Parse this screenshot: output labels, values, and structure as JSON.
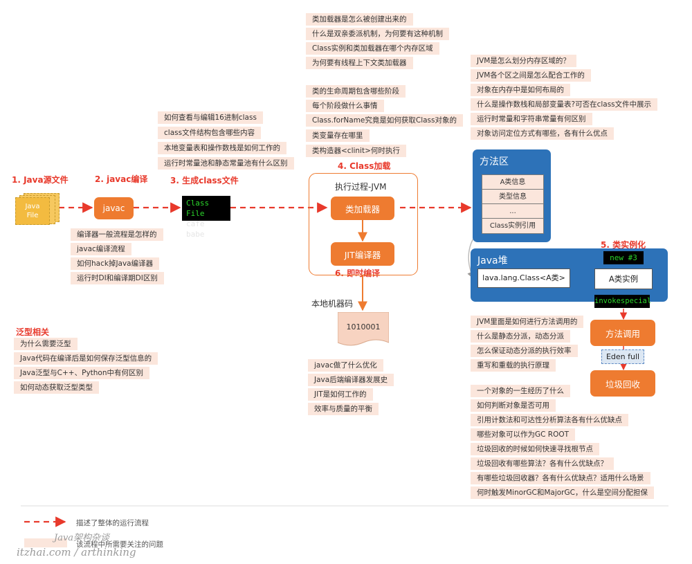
{
  "stages": {
    "java_source": "1. Java源文件",
    "javac_compile": "2. javac编译",
    "gen_class": "3. 生成class文件",
    "class_load": "4. Class加载",
    "instantiate": "5. 类实例化",
    "jit": "6. 即时编译"
  },
  "nodes": {
    "java_file": "Java\nFile",
    "javac": "javac",
    "class_file_line1": "Class File",
    "class_file_line2": "cafe babe",
    "jvm_title": "执行过程-JVM",
    "class_loader": "类加载器",
    "jit_compiler": "JIT编译器",
    "native_code_label": "本地机器码",
    "native_code": "1010001",
    "method_area": {
      "title": "方法区",
      "rows": [
        "A类信息",
        "类型信息",
        "...",
        "Class实例引用"
      ]
    },
    "heap": {
      "title": "Java堆",
      "class_obj": "lava.lang.Class<A类>",
      "instance": "A类实例",
      "new_cmd": "new #3",
      "invoke_cmd": "invokespecial"
    },
    "method_call": "方法调用",
    "eden_full": "Eden full",
    "gc": "垃圾回收"
  },
  "questions": {
    "class_file": [
      "如何查看与编辑16进制class",
      "class文件结构包含哪些内容",
      "本地变量表和操作数栈是如何工作的",
      "运行时常量池和静态常量池有什么区别"
    ],
    "javac": [
      "编译器一般流程是怎样的",
      "javac编译流程",
      "如何hack掉Java编译器",
      "运行时DI和编译期DI区别"
    ],
    "generics_title": "泛型相关",
    "generics": [
      "为什么需要泛型",
      "Java代码在编译后是如何保存泛型信息的",
      "Java泛型与C++、Python中有何区别",
      "如何动态获取泛型类型"
    ],
    "class_loader": [
      "类加载器是怎么被创建出来的",
      "什么是双亲委派机制，为何要有这种机制",
      "Class实例和类加载器在哪个内存区域",
      "为何要有线程上下文类加载器"
    ],
    "lifecycle": [
      "类的生命周期包含哪些阶段",
      "每个阶段做什么事情",
      "Class.forName究竟是如何获取Class对象的",
      "类变量存在哪里",
      "类构造器<clinit>何时执行"
    ],
    "memory": [
      "JVM是怎么划分内存区域的？",
      "JVM各个区之间是怎么配合工作的",
      "对象在内存中是如何布局的",
      "什么是操作数栈和局部变量表?可否在class文件中展示",
      "运行时常量和字符串常量有何区别",
      "对象访问定位方式有哪些，各有什么优点"
    ],
    "jit": [
      "javac做了什么优化",
      "Java后端编译器发展史",
      "JIT是如何工作的",
      "效率与质量的平衡"
    ],
    "method": [
      "JVM里面是如何进行方法调用的",
      "什么是静态分派，动态分派",
      "怎么保证动态分派的执行效率",
      "重写和重载的执行原理"
    ],
    "gc": [
      "一个对象的一生经历了什么",
      "如何判断对象是否可用",
      "引用计数法和可达性分析算法各有什么优缺点",
      "哪些对象可以作为GC ROOT",
      "垃圾回收的时候如何快速寻找根节点",
      "垃圾回收有哪些算法？各有什么优缺点？",
      "有哪些垃圾回收器？各有什么优缺点？适用什么场景",
      "何时触发MinorGC和MajorGC，什么是空间分配担保"
    ]
  },
  "legend": {
    "flow": "描述了整体的运行流程",
    "question": "该流程中所需要关注的问题"
  },
  "watermark": {
    "line1": "Java架构杂谈",
    "line2": "itzhai.com / arthinking"
  },
  "colors": {
    "accent_red": "#e8392b",
    "orange": "#ee7b30",
    "chip_bg": "#fbe6dc",
    "blue": "#2d72b8"
  }
}
